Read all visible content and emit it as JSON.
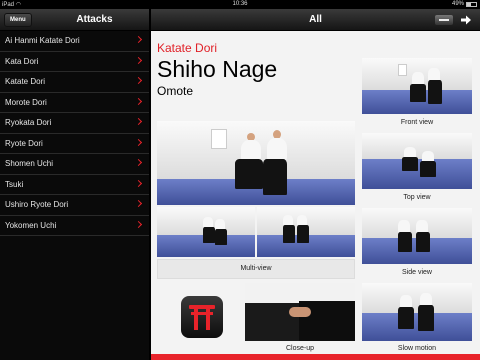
{
  "status": {
    "device": "iPad",
    "wifi_icon": "wifi-icon",
    "time": "10:36",
    "battery": "49%",
    "battery_level": 0.49
  },
  "left": {
    "menu_label": "Menu",
    "title": "Attacks",
    "items": [
      "Ai Hanmi Katate Dori",
      "Kata Dori",
      "Katate Dori",
      "Morote Dori",
      "Ryokata Dori",
      "Ryote Dori",
      "Shomen Uchi",
      "Tsuki",
      "Ushiro Ryote Dori",
      "Yokomen Uchi"
    ]
  },
  "right": {
    "title": "All",
    "attack": "Katate Dori",
    "technique": "Shiho Nage",
    "variant": "Omote",
    "captions": {
      "front": "Front view",
      "top": "Top view",
      "side": "Side view",
      "multi": "Multi-view",
      "closeup": "Close-up",
      "slow": "Slow motion"
    }
  },
  "colors": {
    "accent": "#e8232a",
    "mat": "#5a6bb0",
    "background": "#f3f3f3"
  },
  "icons": {
    "back": "minus-icon",
    "forward": "arrow-right-icon",
    "app": "torii-gate-icon",
    "chevron": "chevron-right-icon"
  }
}
